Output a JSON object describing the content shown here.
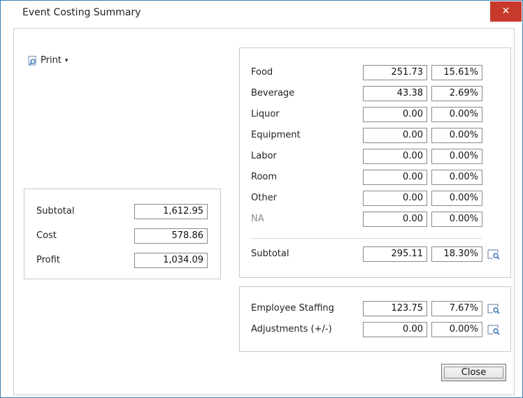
{
  "window": {
    "title": "Event Costing Summary",
    "close_glyph": "✕"
  },
  "toolbar": {
    "print_label": "Print",
    "print_caret": "▾"
  },
  "left_panel": {
    "rows": [
      {
        "label": "Subtotal",
        "value": "1,612.95"
      },
      {
        "label": "Cost",
        "value": "578.86"
      },
      {
        "label": "Profit",
        "value": "1,034.09"
      }
    ]
  },
  "categories_panel": {
    "rows": [
      {
        "label": "Food",
        "amount": "251.73",
        "percent": "15.61%"
      },
      {
        "label": "Beverage",
        "amount": "43.38",
        "percent": "2.69%"
      },
      {
        "label": "Liquor",
        "amount": "0.00",
        "percent": "0.00%"
      },
      {
        "label": "Equipment",
        "amount": "0.00",
        "percent": "0.00%"
      },
      {
        "label": "Labor",
        "amount": "0.00",
        "percent": "0.00%"
      },
      {
        "label": "Room",
        "amount": "0.00",
        "percent": "0.00%"
      },
      {
        "label": "Other",
        "amount": "0.00",
        "percent": "0.00%"
      },
      {
        "label": "NA",
        "amount": "0.00",
        "percent": "0.00%"
      }
    ],
    "subtotal": {
      "label": "Subtotal",
      "amount": "295.11",
      "percent": "18.30%"
    }
  },
  "staffing_panel": {
    "rows": [
      {
        "label": "Employee Staffing",
        "amount": "123.75",
        "percent": "7.67%"
      },
      {
        "label": "Adjustments (+/-)",
        "amount": "0.00",
        "percent": "0.00%"
      }
    ]
  },
  "footer": {
    "close_label": "Close"
  },
  "colors": {
    "close_red": "#c7392b",
    "border_blue": "#3c7fb1",
    "icon_blue": "#2f6fb0"
  }
}
